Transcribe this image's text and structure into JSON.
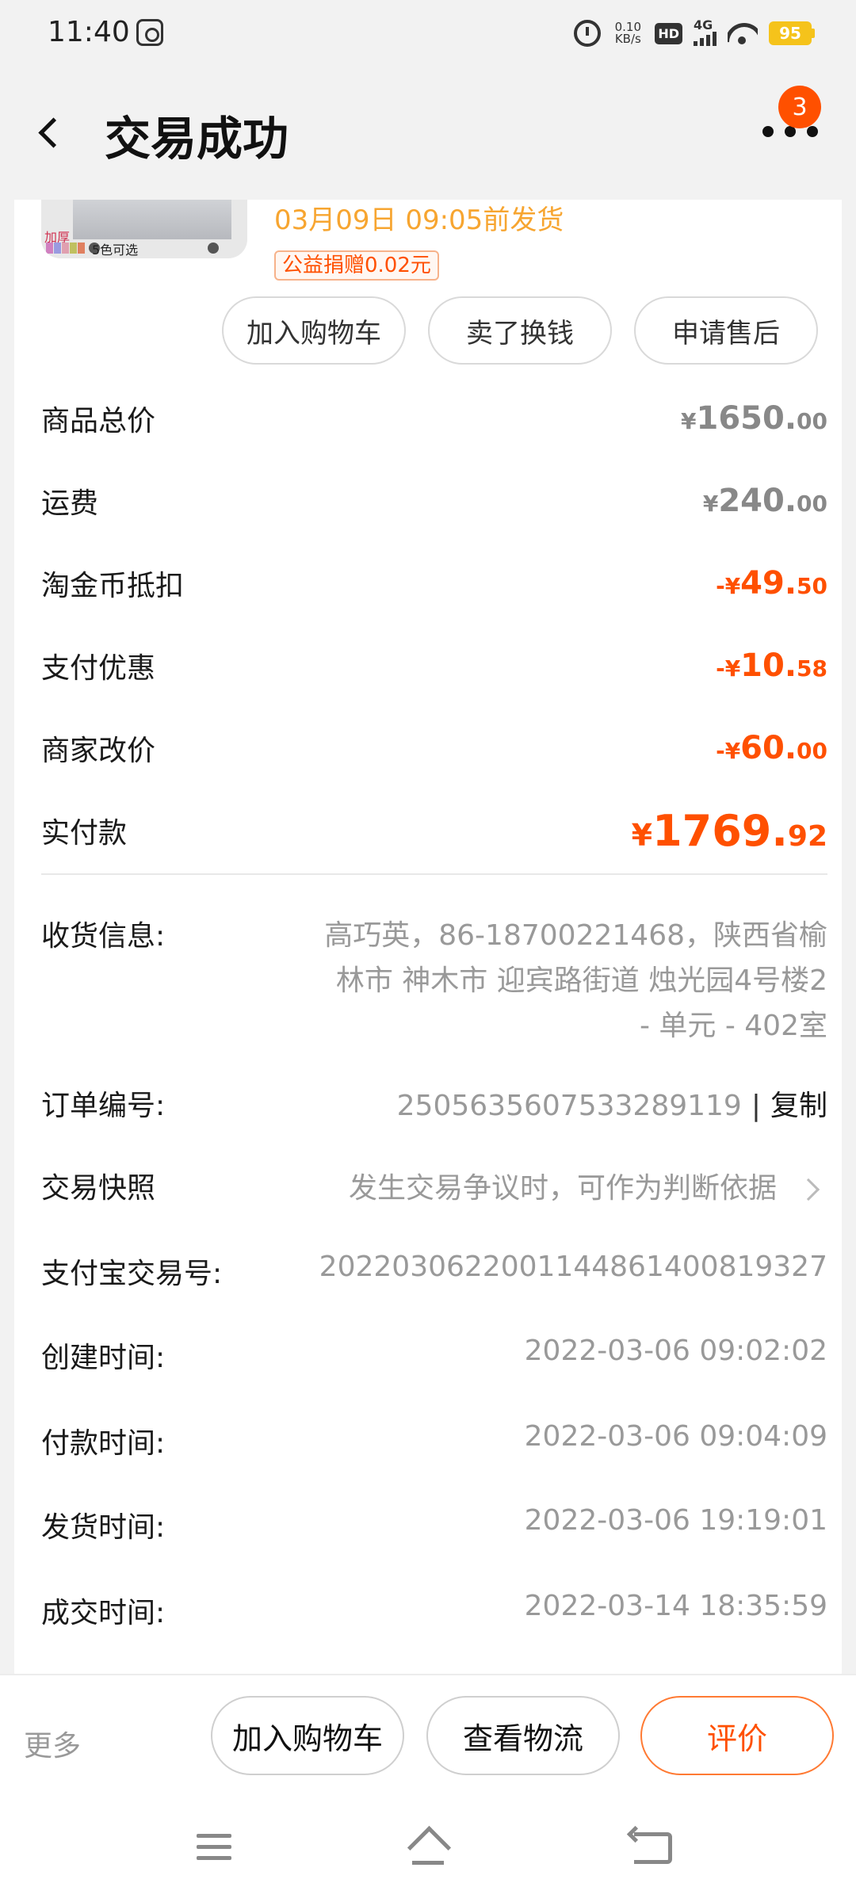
{
  "status_bar": {
    "time": "11:40",
    "net_speed_value": "0.10",
    "net_speed_unit": "KB/s",
    "hd_label": "HD",
    "network_type": "4G",
    "battery_level": "95"
  },
  "header": {
    "title": "交易成功",
    "badge_count": "3"
  },
  "product": {
    "image_label_thick": "加厚",
    "image_label_colors": "5色可选",
    "ship_deadline": "03月09日  09:05前发货",
    "charity_tag": "公益捐赠0.02元"
  },
  "card_actions": {
    "add_to_cart": "加入购物车",
    "resell": "卖了换钱",
    "after_sales": "申请售后"
  },
  "price_breakdown": [
    {
      "label": "商品总价",
      "sign": "",
      "int": "1650.",
      "dec": "00"
    },
    {
      "label": "运费",
      "sign": "",
      "int": "240.",
      "dec": "00"
    },
    {
      "label": "淘金币抵扣",
      "sign": "-",
      "int": "49.",
      "dec": "50"
    },
    {
      "label": "支付优惠",
      "sign": "-",
      "int": "10.",
      "dec": "58"
    },
    {
      "label": "商家改价",
      "sign": "-",
      "int": "60.",
      "dec": "00"
    },
    {
      "label": "实付款",
      "sign": "",
      "int": "1769.",
      "dec": "92"
    }
  ],
  "currency_symbol": "¥",
  "order_info": {
    "shipping_label": "收货信息:",
    "shipping_value": "高巧英，86-18700221468，陕西省榆林市  神木市  迎宾路街道  烛光园4号楼2 - 单元 - 402室",
    "order_no_label": "订单编号:",
    "order_no_value": "2505635607533289119",
    "copy_sep": "|",
    "copy_label": "复制",
    "snapshot_label": "交易快照",
    "snapshot_value": "发生交易争议时，可作为判断依据",
    "alipay_label": "支付宝交易号:",
    "alipay_value": "2022030622001144861400819327",
    "created_label": "创建时间:",
    "created_value": "2022-03-06  09:02:02",
    "paid_label": "付款时间:",
    "paid_value": "2022-03-06  09:04:09",
    "shipped_label": "发货时间:",
    "shipped_value": "2022-03-06  19:19:01",
    "completed_label": "成交时间:",
    "completed_value": "2022-03-14  18:35:59"
  },
  "bottom_bar": {
    "more": "更多",
    "add_to_cart": "加入购物车",
    "logistics": "查看物流",
    "review": "评价"
  },
  "colors": {
    "accent": "#ff5000",
    "ship_time": "#f7a530",
    "muted": "#999999",
    "battery": "#f5c31b"
  }
}
